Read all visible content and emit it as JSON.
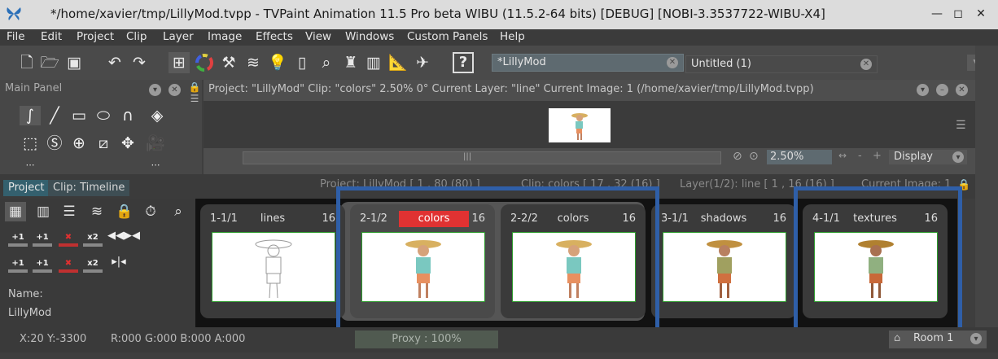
{
  "window": {
    "title": "*/home/xavier/tmp/LillyMod.tvpp - TVPaint Animation 11.5 Pro beta WIBU (11.5.2-64 bits)  [DEBUG] [NOBI-3.3537722-WIBU-X4]",
    "minimize": "—",
    "maximize": "◻",
    "close": "✕"
  },
  "menu": [
    "File",
    "Edit",
    "Project",
    "Clip",
    "Layer",
    "Image",
    "Effects",
    "View",
    "Windows",
    "Custom Panels",
    "Help"
  ],
  "toolbar": {
    "help": "?"
  },
  "docs": {
    "active": "*LillyMod",
    "inactive": "Untitled (1)"
  },
  "main_panel": {
    "title": "Main Panel"
  },
  "project_panel": {
    "header": "Project: \"LillyMod\"  Clip: \"colors\"  2.50%  0°  Current Layer: \"line\"  Current Image: 1 (/home/xavier/tmp/LillyMod.tvpp)",
    "zoom": "2.50%",
    "display": "Display",
    "scroll_grip": "|||"
  },
  "tabs": {
    "project": "Project",
    "timeline": "Clip: Timeline"
  },
  "info": {
    "project": "Project: LillyMod [ 1 , 80 (80) ]",
    "clip": "Clip: colors [ 17 , 32 (16) ]",
    "layer": "Layer(1/2): line [ 1 , 16 (16) ]",
    "image": "Current Image: 1"
  },
  "left_panel": {
    "name_label": "Name:",
    "name_value": "LillyMod",
    "ops": [
      {
        "top": "+1",
        "bar": "gray"
      },
      {
        "top": "+1",
        "bar": "gray"
      },
      {
        "top": "✖",
        "bar": "red"
      },
      {
        "top": "x2",
        "bar": "gray"
      }
    ]
  },
  "clips": [
    {
      "num": "1-1/1",
      "name": "lines",
      "count": "16",
      "selected": false
    },
    {
      "num": "2-1/2",
      "name": "colors",
      "count": "16",
      "selected": true
    },
    {
      "num": "2-2/2",
      "name": "colors",
      "count": "16",
      "selected": false
    },
    {
      "num": "3-1/1",
      "name": "shadows",
      "count": "16",
      "selected": false
    },
    {
      "num": "4-1/1",
      "name": "textures",
      "count": "16",
      "selected": false
    }
  ],
  "status": {
    "coords": "X:20  Y:-3300",
    "rgba": "R:000 G:000 B:000 A:000",
    "proxy": "Proxy : 100%",
    "room": "Room 1"
  },
  "colors": {
    "highlight": "#2f5fa8",
    "selected_clip": "#e03232",
    "frame_border": "#2e9c2e"
  }
}
